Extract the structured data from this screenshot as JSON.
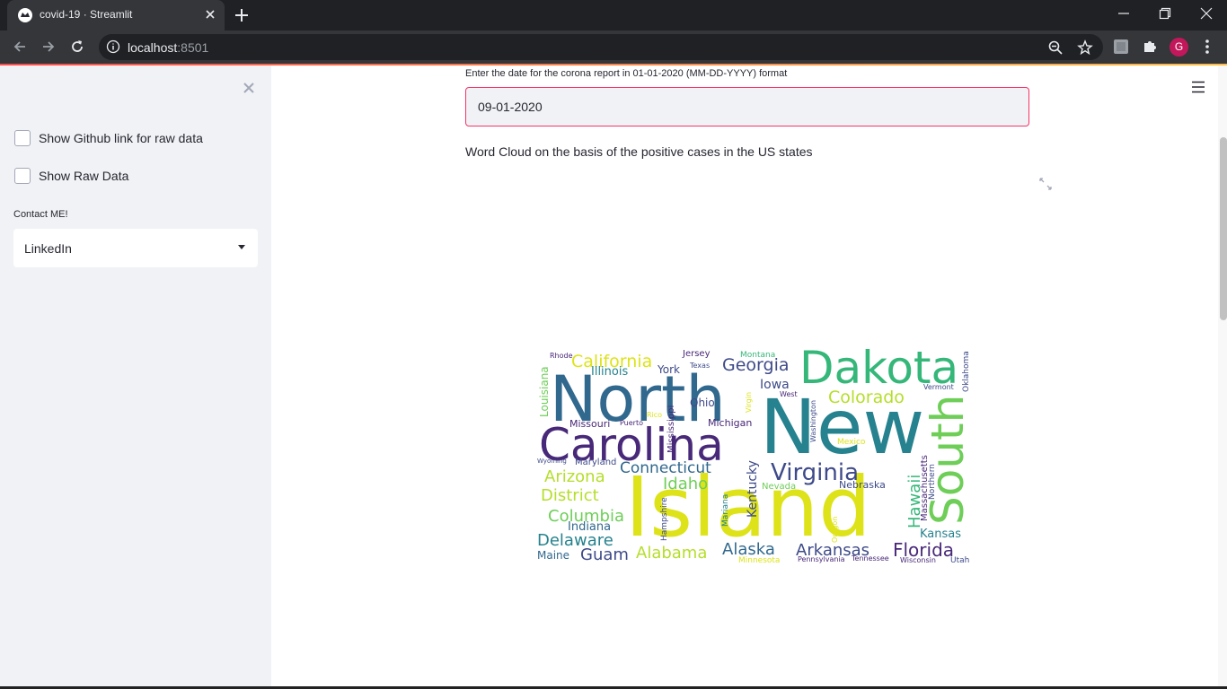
{
  "browser": {
    "tab_title": "covid-19 · Streamlit",
    "url_host": "localhost",
    "url_port": ":8501",
    "profile_initial": "G"
  },
  "sidebar": {
    "checkboxes": [
      {
        "label": "Show Github link for raw data",
        "checked": false
      },
      {
        "label": "Show Raw Data",
        "checked": false
      }
    ],
    "contact_label": "Contact ME!",
    "contact_select": {
      "value": "LinkedIn"
    }
  },
  "main": {
    "date_label": "Enter the date for the corona report in 01-01-2020 (MM-DD-YYYY) format",
    "date_value": "09-01-2020",
    "description": "Word Cloud on the basis of the positive cases in the US states"
  },
  "wordcloud": {
    "colors": {
      "purple": "#482878",
      "blue": "#3e4a89",
      "teal": "#26828e",
      "green": "#35b779",
      "yellow": "#dde318",
      "lightgreen": "#6ece58"
    },
    "words": [
      {
        "text": "Island",
        "weight": 1.0,
        "color": "#dde318"
      },
      {
        "text": "New",
        "weight": 0.95,
        "color": "#26828e"
      },
      {
        "text": "North",
        "weight": 0.85,
        "color": "#31688e"
      },
      {
        "text": "Carolina",
        "weight": 0.7,
        "color": "#482878"
      },
      {
        "text": "Dakota",
        "weight": 0.65,
        "color": "#35b779"
      },
      {
        "text": "South",
        "weight": 0.6,
        "color": "#6ece58"
      },
      {
        "text": "Virginia",
        "weight": 0.35,
        "color": "#3e4a89"
      },
      {
        "text": "California",
        "weight": 0.28,
        "color": "#dde318"
      },
      {
        "text": "Georgia",
        "weight": 0.27,
        "color": "#3e4a89"
      },
      {
        "text": "Colorado",
        "weight": 0.27,
        "color": "#b5de2b"
      },
      {
        "text": "Connecticut",
        "weight": 0.25,
        "color": "#31688e"
      },
      {
        "text": "Arizona",
        "weight": 0.24,
        "color": "#b5de2b"
      },
      {
        "text": "District",
        "weight": 0.24,
        "color": "#b5de2b"
      },
      {
        "text": "Columbia",
        "weight": 0.24,
        "color": "#6ece58"
      },
      {
        "text": "Delaware",
        "weight": 0.23,
        "color": "#26828e"
      },
      {
        "text": "Alabama",
        "weight": 0.23,
        "color": "#b5de2b"
      },
      {
        "text": "Alaska",
        "weight": 0.23,
        "color": "#31688e"
      },
      {
        "text": "Arkansas",
        "weight": 0.23,
        "color": "#3e4a89"
      },
      {
        "text": "Florida",
        "weight": 0.23,
        "color": "#482878"
      },
      {
        "text": "Idaho",
        "weight": 0.23,
        "color": "#6ece58"
      },
      {
        "text": "Guam",
        "weight": 0.22,
        "color": "#3e4a89"
      },
      {
        "text": "Hawaii",
        "weight": 0.22,
        "color": "#35b779"
      },
      {
        "text": "Illinois",
        "weight": 0.17,
        "color": "#26828e"
      },
      {
        "text": "Indiana",
        "weight": 0.16,
        "color": "#31688e"
      },
      {
        "text": "Iowa",
        "weight": 0.16,
        "color": "#3e4a89"
      },
      {
        "text": "Kentucky",
        "weight": 0.16,
        "color": "#3e4a89"
      },
      {
        "text": "Kansas",
        "weight": 0.15,
        "color": "#26828e"
      },
      {
        "text": "Louisiana",
        "weight": 0.15,
        "color": "#6ece58"
      },
      {
        "text": "Maine",
        "weight": 0.14,
        "color": "#31688e"
      },
      {
        "text": "York",
        "weight": 0.13,
        "color": "#3e4a89"
      },
      {
        "text": "Ohio",
        "weight": 0.13,
        "color": "#3e4a89"
      },
      {
        "text": "Michigan",
        "weight": 0.12,
        "color": "#482878"
      },
      {
        "text": "Missouri",
        "weight": 0.12,
        "color": "#482878"
      },
      {
        "text": "Maryland",
        "weight": 0.11,
        "color": "#3e4a89"
      },
      {
        "text": "Mississippi",
        "weight": 0.11,
        "color": "#482878"
      },
      {
        "text": "Massachusetts",
        "weight": 0.11,
        "color": "#482878"
      },
      {
        "text": "Nebraska",
        "weight": 0.11,
        "color": "#3e4a89"
      },
      {
        "text": "Nevada",
        "weight": 0.1,
        "color": "#6ece58"
      },
      {
        "text": "Jersey",
        "weight": 0.1,
        "color": "#482878"
      },
      {
        "text": "Montana",
        "weight": 0.09,
        "color": "#35b779"
      },
      {
        "text": "Oklahoma",
        "weight": 0.09,
        "color": "#3e4a89"
      },
      {
        "text": "Hampshire",
        "weight": 0.09,
        "color": "#3e4a89"
      },
      {
        "text": "Mariana",
        "weight": 0.09,
        "color": "#26828e"
      },
      {
        "text": "Northern",
        "weight": 0.09,
        "color": "#3e4a89"
      },
      {
        "text": "Mexico",
        "weight": 0.09,
        "color": "#dde318"
      },
      {
        "text": "Washington",
        "weight": 0.08,
        "color": "#3e4a89"
      },
      {
        "text": "Oregon",
        "weight": 0.08,
        "color": "#dde318"
      },
      {
        "text": "Minnesota",
        "weight": 0.08,
        "color": "#dde318"
      },
      {
        "text": "Pennsylvania",
        "weight": 0.08,
        "color": "#482878"
      },
      {
        "text": "Tennessee",
        "weight": 0.07,
        "color": "#482878"
      },
      {
        "text": "Wisconsin",
        "weight": 0.07,
        "color": "#482878"
      },
      {
        "text": "Utah",
        "weight": 0.07,
        "color": "#3e4a89"
      },
      {
        "text": "Vermont",
        "weight": 0.07,
        "color": "#3e4a89"
      },
      {
        "text": "Texas",
        "weight": 0.07,
        "color": "#3e4a89"
      },
      {
        "text": "Rhode",
        "weight": 0.07,
        "color": "#482878"
      },
      {
        "text": "West",
        "weight": 0.07,
        "color": "#482878"
      },
      {
        "text": "Puerto",
        "weight": 0.07,
        "color": "#482878"
      },
      {
        "text": "Rico",
        "weight": 0.06,
        "color": "#dde318"
      },
      {
        "text": "Wyoming",
        "weight": 0.06,
        "color": "#3e4a89"
      },
      {
        "text": "Virgin",
        "weight": 0.06,
        "color": "#dde318"
      }
    ]
  }
}
